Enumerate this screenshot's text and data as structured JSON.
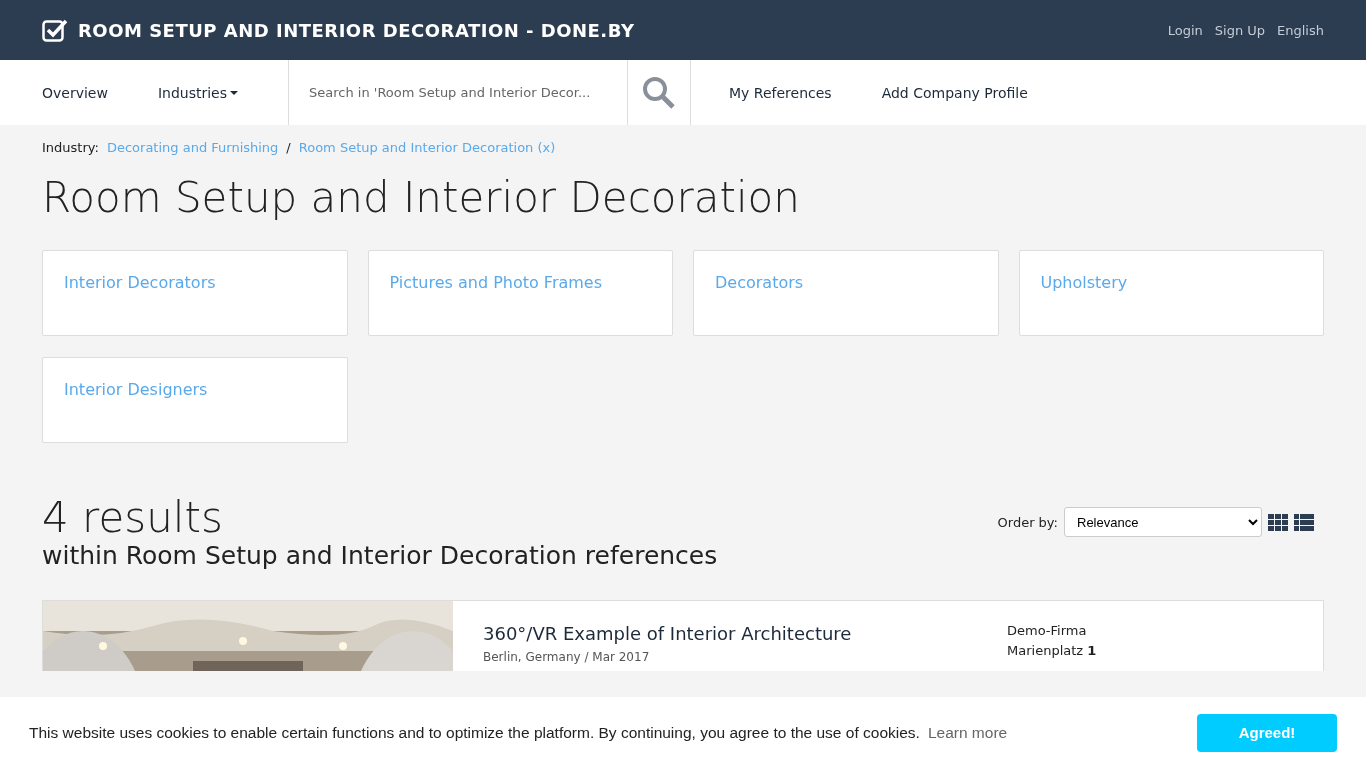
{
  "header": {
    "title": "ROOM SETUP AND INTERIOR DECORATION - DONE.BY",
    "links": [
      "Login",
      "Sign Up",
      "English"
    ]
  },
  "nav": {
    "items": [
      {
        "label": "Overview",
        "dropdown": false
      },
      {
        "label": "Industries",
        "dropdown": true
      }
    ],
    "search": {
      "placeholder": "Search in 'Room Setup and Interior Decor..."
    },
    "links": [
      "My References",
      "Add Company Profile"
    ]
  },
  "breadcrumb": {
    "label": "Industry:",
    "items": [
      "Decorating and Furnishing",
      "Room Setup and Interior Decoration (x)"
    ],
    "separator": "/"
  },
  "page_title": "Room Setup and Interior Decoration",
  "categories": [
    "Interior Decorators",
    "Pictures and Photo Frames",
    "Decorators",
    "Upholstery",
    "Interior Designers"
  ],
  "results": {
    "count": "4 results",
    "subtitle": "within Room Setup and Interior Decoration references",
    "order_label": "Order by:",
    "order_value": "Relevance"
  },
  "items": [
    {
      "kind": "picture",
      "title": "360°/VR Example of Interior Architecture",
      "meta": "Berlin, Germany / Mar 2017",
      "address": [
        "Demo-Firma",
        "Marienplatz **1**"
      ]
    }
  ],
  "cookie": {
    "text": "This website uses cookies to enable certain functions and to optimize the platform. By continuing, you agree to the use of cookies.",
    "link": "Learn more",
    "button": "Agreed!"
  }
}
